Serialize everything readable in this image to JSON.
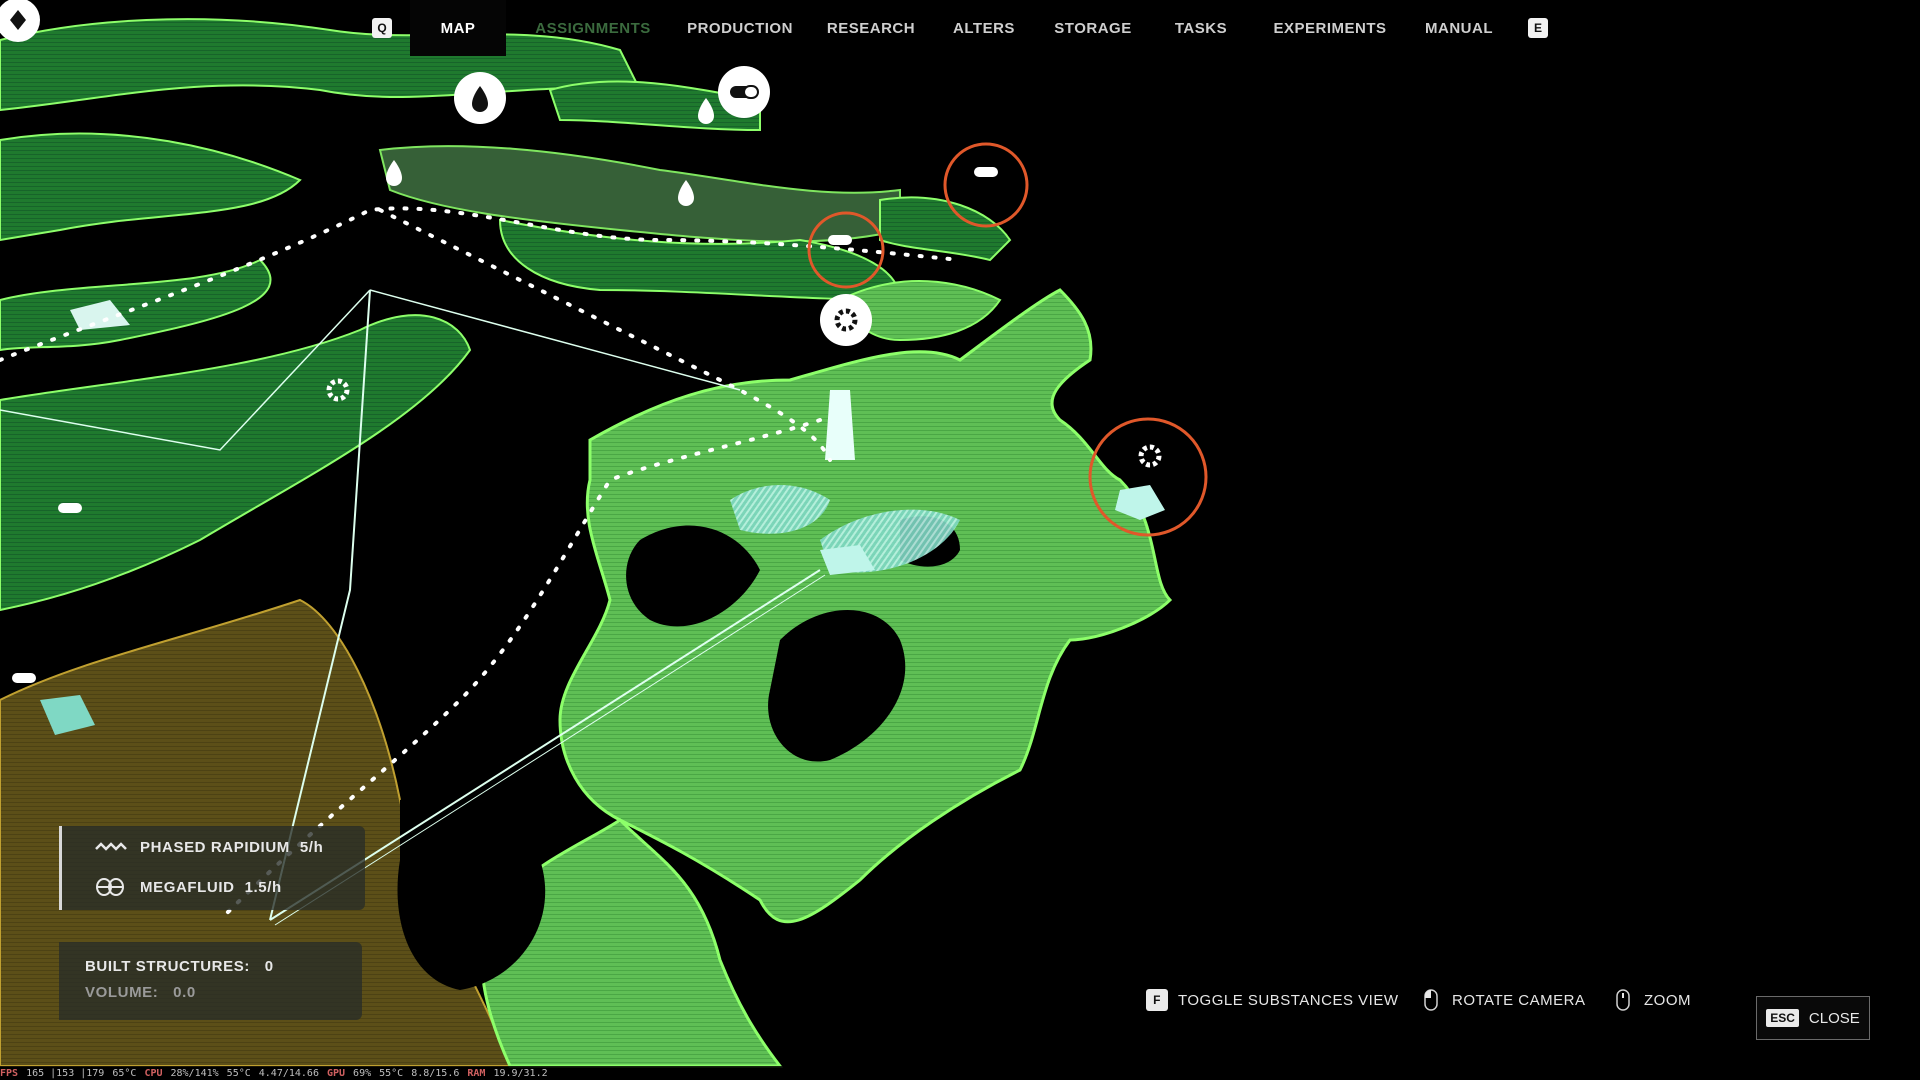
{
  "nav": {
    "left_key": "Q",
    "right_key": "E",
    "tabs": [
      {
        "label": "MAP",
        "active": true
      },
      {
        "label": "ASSIGNMENTS",
        "active": false
      },
      {
        "label": "PRODUCTION",
        "active": false
      },
      {
        "label": "RESEARCH",
        "active": false
      },
      {
        "label": "ALTERS",
        "active": false
      },
      {
        "label": "STORAGE",
        "active": false
      },
      {
        "label": "TASKS",
        "active": false
      },
      {
        "label": "EXPERIMENTS",
        "active": false
      },
      {
        "label": "MANUAL",
        "active": false
      }
    ]
  },
  "resources": [
    {
      "name": "PHASED RAPIDIUM",
      "rate": "5/h",
      "icon": "wave-icon"
    },
    {
      "name": "MEGAFLUID",
      "rate": "1.5/h",
      "icon": "megafluid-icon"
    }
  ],
  "stats": {
    "built_label": "BUILT STRUCTURES:",
    "built_value": "0",
    "volume_label": "VOLUME:",
    "volume_value": "0.0"
  },
  "controls": {
    "toggle_key": "F",
    "toggle_label": "TOGGLE SUBSTANCES VIEW",
    "rotate_label": "ROTATE CAMERA",
    "zoom_label": "ZOOM",
    "close_key": "ESC",
    "close_label": "CLOSE"
  },
  "perf": {
    "fps_label": "FPS",
    "fps": "165 |153 |179",
    "temp1": "65°C",
    "cpu_label": "CPU",
    "cpu": "28%/141%",
    "temp2": "55°C",
    "clock": "4.47/14.66",
    "gpu_label": "GPU",
    "gpu": "69%",
    "temp3": "55°C",
    "vram": "8.8/15.6",
    "ram_label": "RAM",
    "ram": "19.9/31.2"
  },
  "colors": {
    "terrain_bright": "#5fbf55",
    "terrain_dark": "#1d6e2a",
    "terrain_edge": "#8dff6a",
    "ochre_zone": "#6b5a1e",
    "structure": "#bff5ea",
    "marker_ring": "#e0582a"
  },
  "map_markers": [
    {
      "type": "droplet-icon"
    },
    {
      "type": "droplet-icon"
    },
    {
      "type": "droplet-icon"
    },
    {
      "type": "gear-icon"
    },
    {
      "type": "gear-icon"
    },
    {
      "type": "pill-icon"
    },
    {
      "type": "pill-icon"
    },
    {
      "type": "pill-icon"
    },
    {
      "type": "pill-icon"
    }
  ]
}
